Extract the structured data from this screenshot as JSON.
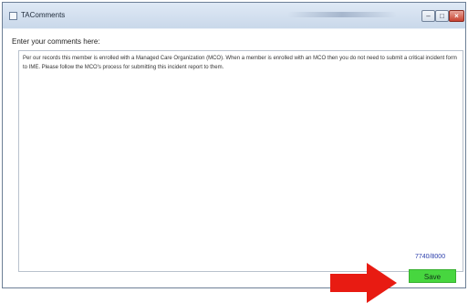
{
  "window": {
    "title": "TAComments",
    "minimize_label": "–",
    "maximize_label": "□",
    "close_label": "×"
  },
  "form": {
    "prompt": "Enter your comments here:",
    "comment": "Per our records this member is enrolled with a Managed Care Organization (MCO). When a member is enrolled with an MCO then you do not need to submit a critical incident form to IME. Please follow the MCO's process for submitting this incident report to them.",
    "char_count": "7740/8000",
    "save_label": "Save"
  },
  "colors": {
    "save_button": "#47d63f",
    "arrow": "#e81b12",
    "counter_text": "#2a3dab"
  },
  "icons": {
    "app": "app-window-icon",
    "annotation": "red-arrow-icon"
  }
}
